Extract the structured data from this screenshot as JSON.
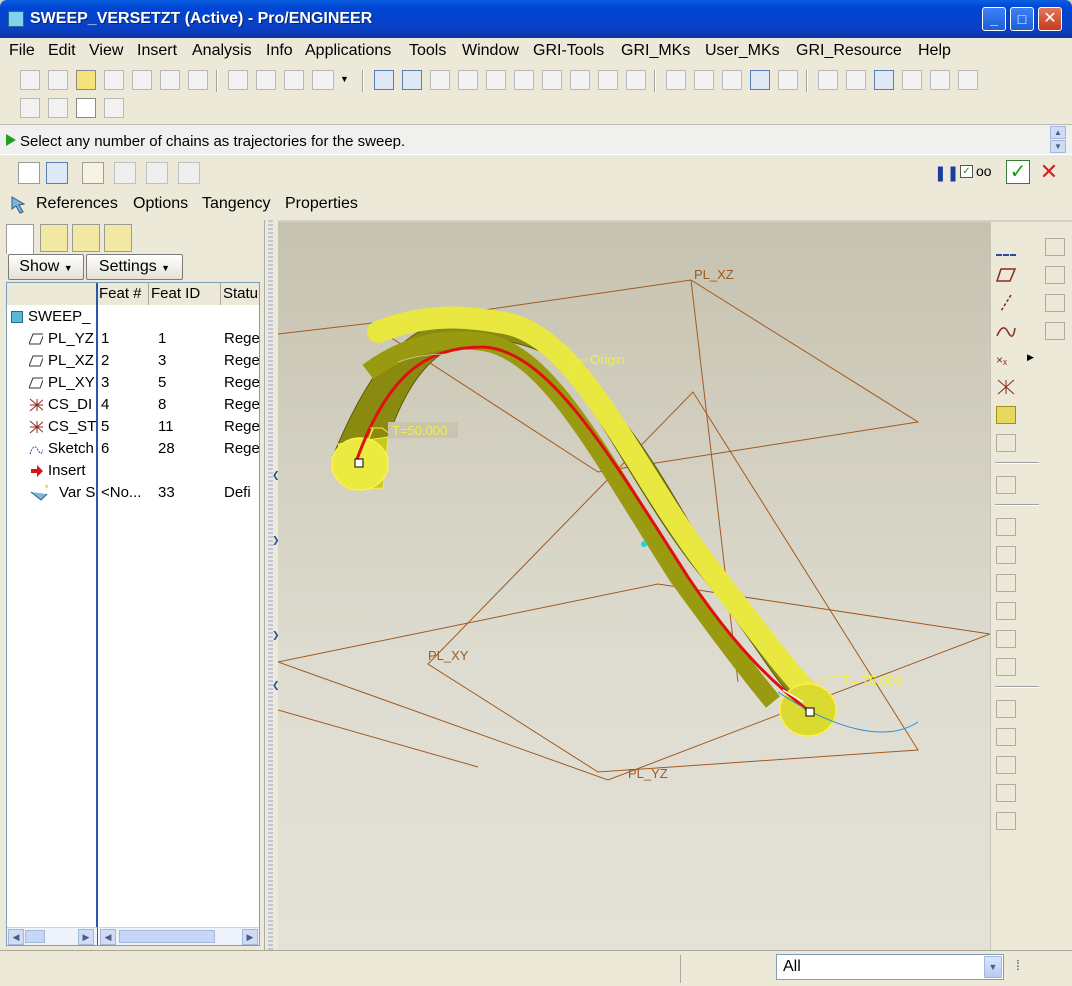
{
  "window": {
    "title": "SWEEP_VERSETZT (Active) - Pro/ENGINEER",
    "minimize": "_",
    "maximize": "□",
    "close": "✕"
  },
  "menu": [
    "File",
    "Edit",
    "View",
    "Insert",
    "Analysis",
    "Info",
    "Applications",
    "Tools",
    "Window",
    "GRI-Tools",
    "GRI_MKs",
    "User_MKs",
    "GRI_Resource",
    "Help"
  ],
  "message": "Select any number of chains as trajectories for the sweep.",
  "dashboard_tabs": [
    "References",
    "Options",
    "Tangency",
    "Properties"
  ],
  "panel": {
    "show_label": "Show",
    "settings_label": "Settings",
    "columns": [
      "",
      "Feat #",
      "Feat ID",
      "Statu"
    ],
    "root": "SWEEP_",
    "rows": [
      {
        "name": "PL_YZ",
        "num": "1",
        "id": "1",
        "status": "Rege",
        "icon": "datum-plane-icon"
      },
      {
        "name": "PL_XZ",
        "num": "2",
        "id": "3",
        "status": "Rege",
        "icon": "datum-plane-icon"
      },
      {
        "name": "PL_XY",
        "num": "3",
        "id": "5",
        "status": "Rege",
        "icon": "datum-plane-icon"
      },
      {
        "name": "CS_DI",
        "num": "4",
        "id": "8",
        "status": "Rege",
        "icon": "coord-sys-icon"
      },
      {
        "name": "CS_ST",
        "num": "5",
        "id": "11",
        "status": "Rege",
        "icon": "coord-sys-icon"
      },
      {
        "name": "Sketch",
        "num": "6",
        "id": "28",
        "status": "Rege",
        "icon": "sketch-icon"
      },
      {
        "name": "Insert",
        "num": "",
        "id": "",
        "status": "",
        "icon": "insert-arrow-icon"
      },
      {
        "name": "Var S",
        "num": "<No...",
        "id": "33",
        "status": "Defi",
        "icon": "var-sweep-icon"
      }
    ]
  },
  "viewport": {
    "labels": {
      "pl_xz": "PL_XZ",
      "pl_xy": "PL_XY",
      "pl_yz": "PL_YZ",
      "origin": "Origin",
      "t_start": "T=50.000",
      "t_end": "T=-75.000"
    }
  },
  "status": {
    "filter": "All"
  }
}
